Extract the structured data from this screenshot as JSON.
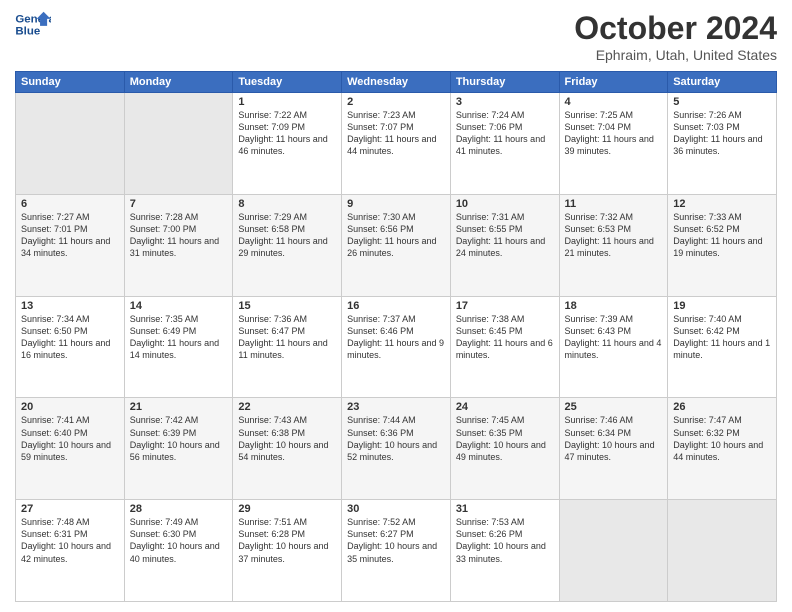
{
  "header": {
    "logo_line1": "General",
    "logo_line2": "Blue",
    "month": "October 2024",
    "location": "Ephraim, Utah, United States"
  },
  "weekdays": [
    "Sunday",
    "Monday",
    "Tuesday",
    "Wednesday",
    "Thursday",
    "Friday",
    "Saturday"
  ],
  "weeks": [
    [
      {
        "day": "",
        "info": ""
      },
      {
        "day": "",
        "info": ""
      },
      {
        "day": "1",
        "info": "Sunrise: 7:22 AM\nSunset: 7:09 PM\nDaylight: 11 hours and 46 minutes."
      },
      {
        "day": "2",
        "info": "Sunrise: 7:23 AM\nSunset: 7:07 PM\nDaylight: 11 hours and 44 minutes."
      },
      {
        "day": "3",
        "info": "Sunrise: 7:24 AM\nSunset: 7:06 PM\nDaylight: 11 hours and 41 minutes."
      },
      {
        "day": "4",
        "info": "Sunrise: 7:25 AM\nSunset: 7:04 PM\nDaylight: 11 hours and 39 minutes."
      },
      {
        "day": "5",
        "info": "Sunrise: 7:26 AM\nSunset: 7:03 PM\nDaylight: 11 hours and 36 minutes."
      }
    ],
    [
      {
        "day": "6",
        "info": "Sunrise: 7:27 AM\nSunset: 7:01 PM\nDaylight: 11 hours and 34 minutes."
      },
      {
        "day": "7",
        "info": "Sunrise: 7:28 AM\nSunset: 7:00 PM\nDaylight: 11 hours and 31 minutes."
      },
      {
        "day": "8",
        "info": "Sunrise: 7:29 AM\nSunset: 6:58 PM\nDaylight: 11 hours and 29 minutes."
      },
      {
        "day": "9",
        "info": "Sunrise: 7:30 AM\nSunset: 6:56 PM\nDaylight: 11 hours and 26 minutes."
      },
      {
        "day": "10",
        "info": "Sunrise: 7:31 AM\nSunset: 6:55 PM\nDaylight: 11 hours and 24 minutes."
      },
      {
        "day": "11",
        "info": "Sunrise: 7:32 AM\nSunset: 6:53 PM\nDaylight: 11 hours and 21 minutes."
      },
      {
        "day": "12",
        "info": "Sunrise: 7:33 AM\nSunset: 6:52 PM\nDaylight: 11 hours and 19 minutes."
      }
    ],
    [
      {
        "day": "13",
        "info": "Sunrise: 7:34 AM\nSunset: 6:50 PM\nDaylight: 11 hours and 16 minutes."
      },
      {
        "day": "14",
        "info": "Sunrise: 7:35 AM\nSunset: 6:49 PM\nDaylight: 11 hours and 14 minutes."
      },
      {
        "day": "15",
        "info": "Sunrise: 7:36 AM\nSunset: 6:47 PM\nDaylight: 11 hours and 11 minutes."
      },
      {
        "day": "16",
        "info": "Sunrise: 7:37 AM\nSunset: 6:46 PM\nDaylight: 11 hours and 9 minutes."
      },
      {
        "day": "17",
        "info": "Sunrise: 7:38 AM\nSunset: 6:45 PM\nDaylight: 11 hours and 6 minutes."
      },
      {
        "day": "18",
        "info": "Sunrise: 7:39 AM\nSunset: 6:43 PM\nDaylight: 11 hours and 4 minutes."
      },
      {
        "day": "19",
        "info": "Sunrise: 7:40 AM\nSunset: 6:42 PM\nDaylight: 11 hours and 1 minute."
      }
    ],
    [
      {
        "day": "20",
        "info": "Sunrise: 7:41 AM\nSunset: 6:40 PM\nDaylight: 10 hours and 59 minutes."
      },
      {
        "day": "21",
        "info": "Sunrise: 7:42 AM\nSunset: 6:39 PM\nDaylight: 10 hours and 56 minutes."
      },
      {
        "day": "22",
        "info": "Sunrise: 7:43 AM\nSunset: 6:38 PM\nDaylight: 10 hours and 54 minutes."
      },
      {
        "day": "23",
        "info": "Sunrise: 7:44 AM\nSunset: 6:36 PM\nDaylight: 10 hours and 52 minutes."
      },
      {
        "day": "24",
        "info": "Sunrise: 7:45 AM\nSunset: 6:35 PM\nDaylight: 10 hours and 49 minutes."
      },
      {
        "day": "25",
        "info": "Sunrise: 7:46 AM\nSunset: 6:34 PM\nDaylight: 10 hours and 47 minutes."
      },
      {
        "day": "26",
        "info": "Sunrise: 7:47 AM\nSunset: 6:32 PM\nDaylight: 10 hours and 44 minutes."
      }
    ],
    [
      {
        "day": "27",
        "info": "Sunrise: 7:48 AM\nSunset: 6:31 PM\nDaylight: 10 hours and 42 minutes."
      },
      {
        "day": "28",
        "info": "Sunrise: 7:49 AM\nSunset: 6:30 PM\nDaylight: 10 hours and 40 minutes."
      },
      {
        "day": "29",
        "info": "Sunrise: 7:51 AM\nSunset: 6:28 PM\nDaylight: 10 hours and 37 minutes."
      },
      {
        "day": "30",
        "info": "Sunrise: 7:52 AM\nSunset: 6:27 PM\nDaylight: 10 hours and 35 minutes."
      },
      {
        "day": "31",
        "info": "Sunrise: 7:53 AM\nSunset: 6:26 PM\nDaylight: 10 hours and 33 minutes."
      },
      {
        "day": "",
        "info": ""
      },
      {
        "day": "",
        "info": ""
      }
    ]
  ]
}
